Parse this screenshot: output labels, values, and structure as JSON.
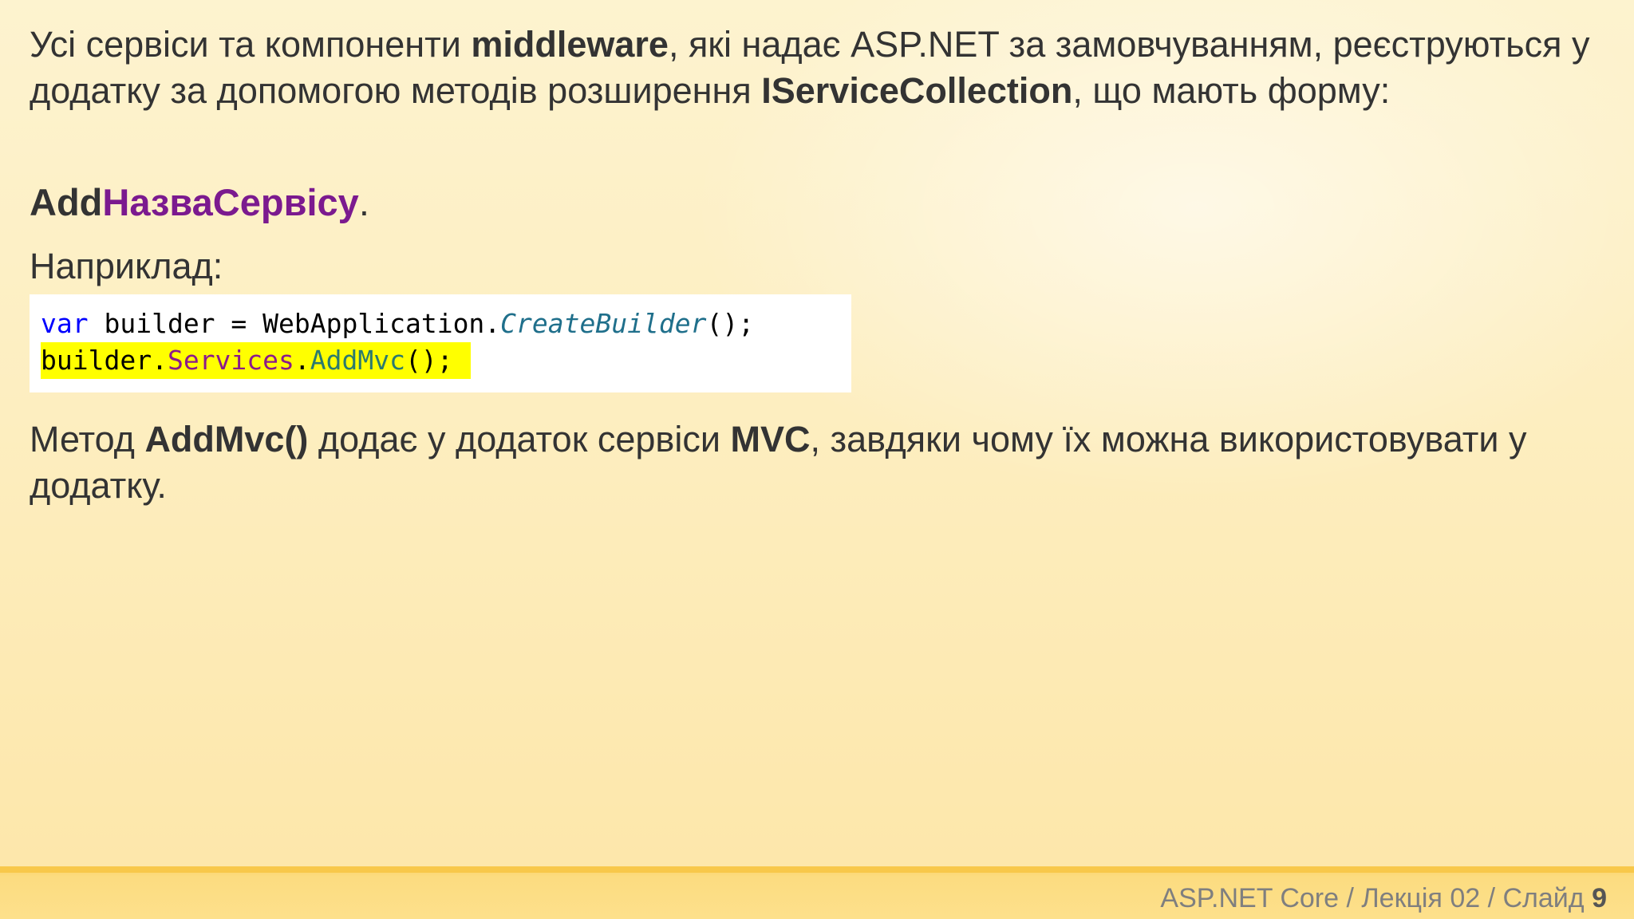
{
  "intro": {
    "part1": "Усі сервіси та компоненти ",
    "bold1": "middleware",
    "part2": ", які надає ASP.NET за замовчуванням, реєструються у додатку за допомогою методів розширення ",
    "bold2": "IServiceCollection",
    "part3": ", що мають форму:"
  },
  "pattern": {
    "prefix": "Add",
    "name": "НазваСервісу",
    "suffix": "."
  },
  "example_label": "Наприклад:",
  "code": {
    "line1": {
      "kw": "var",
      "text1": " builder = WebApplication.",
      "method": "CreateBuilder",
      "text2": "();"
    },
    "line2": {
      "text1": "builder.",
      "prop": "Services",
      "dot": ".",
      "call": "AddMvc",
      "text2": "();"
    }
  },
  "method_desc": {
    "part1": "Метод ",
    "bold1": "AddMvc()",
    "part2": " додає у додаток сервіси ",
    "bold2": "MVC",
    "part3": ", завдяки чому їх можна використовувати у додатку."
  },
  "footer": {
    "text": "ASP.NET Core / Лекція 02 / Слайд ",
    "slide_number": "9"
  },
  "colors": {
    "accent_purple": "#7b1a8f",
    "highlight": "#ffff00",
    "footer_band": "#fbd36a"
  }
}
